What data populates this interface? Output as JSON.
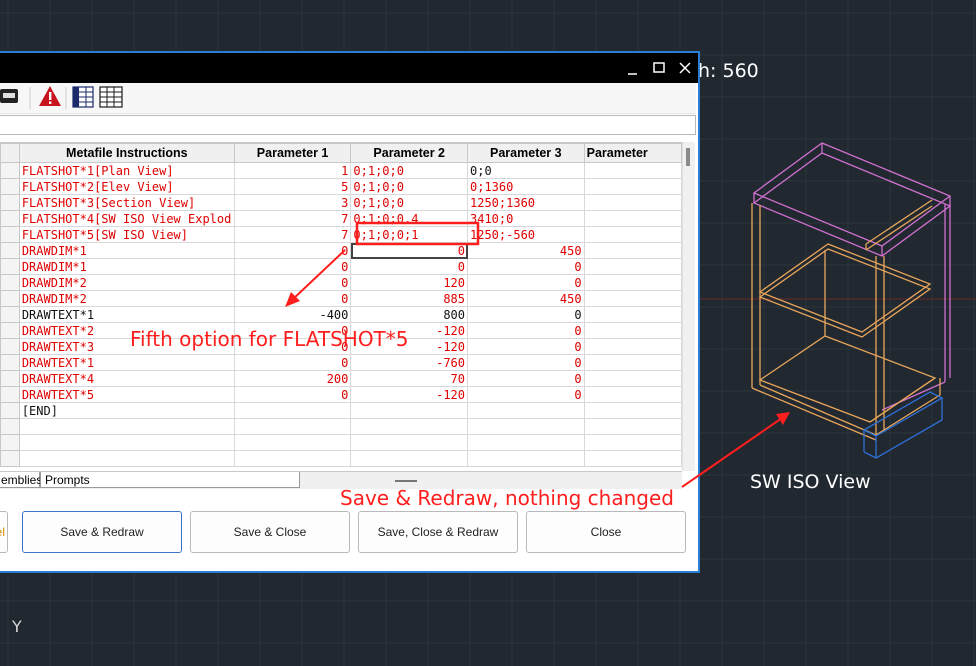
{
  "cad": {
    "top_text": "h: 560",
    "view_label": "SW ISO View",
    "ucs_axis": "Y"
  },
  "window": {
    "minimize": "▭",
    "maximize": "☐",
    "close": "✕"
  },
  "table": {
    "columns": [
      "Metafile Instructions",
      "Parameter 1",
      "Parameter 2",
      "Parameter 3",
      "Parameter"
    ],
    "rows": [
      {
        "c": [
          "FLATSHOT*1[Plan View]",
          "1",
          "0;1;0;0",
          "0;0",
          ""
        ],
        "color": "red",
        "p3": "black"
      },
      {
        "c": [
          "FLATSHOT*2[Elev View]",
          "5",
          "0;1;0;0",
          "0;1360",
          ""
        ],
        "color": "red"
      },
      {
        "c": [
          "FLATSHOT*3[Section View]",
          "3",
          "0;1;0;0",
          "1250;1360",
          ""
        ],
        "color": "red"
      },
      {
        "c": [
          "FLATSHOT*4[SW ISO View Explod",
          "7",
          "0;1;0;0.4",
          "3410;0",
          ""
        ],
        "color": "red"
      },
      {
        "c": [
          "FLATSHOT*5[SW ISO View]",
          "7",
          "0;1;0;0;1",
          "1250;-560",
          ""
        ],
        "color": "red"
      },
      {
        "c": [
          "DRAWDIM*1",
          "0",
          "0",
          "450",
          ""
        ],
        "color": "red"
      },
      {
        "c": [
          "DRAWDIM*1",
          "0",
          "0",
          "0",
          ""
        ],
        "color": "red"
      },
      {
        "c": [
          "DRAWDIM*2",
          "0",
          "120",
          "0",
          ""
        ],
        "color": "red"
      },
      {
        "c": [
          "DRAWDIM*2",
          "0",
          "885",
          "450",
          ""
        ],
        "color": "red"
      },
      {
        "c": [
          "DRAWTEXT*1",
          "-400",
          "800",
          "0",
          ""
        ],
        "color": "black"
      },
      {
        "c": [
          "DRAWTEXT*2",
          "0",
          "-120",
          "0",
          ""
        ],
        "color": "red"
      },
      {
        "c": [
          "DRAWTEXT*3",
          "0",
          "-120",
          "0",
          ""
        ],
        "color": "red"
      },
      {
        "c": [
          "DRAWTEXT*1",
          "0",
          "-760",
          "0",
          ""
        ],
        "color": "red"
      },
      {
        "c": [
          "DRAWTEXT*4",
          "200",
          "70",
          "0",
          ""
        ],
        "color": "red"
      },
      {
        "c": [
          "DRAWTEXT*5",
          "0",
          "-120",
          "0",
          ""
        ],
        "color": "red"
      },
      {
        "c": [
          "[END]",
          "",
          "",
          "",
          ""
        ],
        "color": "black"
      },
      {
        "c": [
          "",
          "",
          "",
          "",
          ""
        ],
        "color": "black"
      },
      {
        "c": [
          "",
          "",
          "",
          "",
          ""
        ],
        "color": "black"
      },
      {
        "c": [
          "",
          "",
          "",
          "",
          ""
        ],
        "color": "black"
      }
    ]
  },
  "tabs": {
    "assemblies": "emblies",
    "prompts": "Prompts"
  },
  "buttons": {
    "left_partial": "el",
    "save_redraw": "Save & Redraw",
    "save_close": "Save & Close",
    "save_close_redraw": "Save, Close & Redraw",
    "close": "Close"
  },
  "annotations": {
    "fifth_option": "Fifth option for FLATSHOT*5",
    "save_redraw_note": "Save & Redraw, nothing changed"
  },
  "colors": {
    "accent": "#2a7fd4",
    "annotation_red": "#ff1e1e",
    "cell_red": "#e00000",
    "cad_background": "#212830"
  }
}
